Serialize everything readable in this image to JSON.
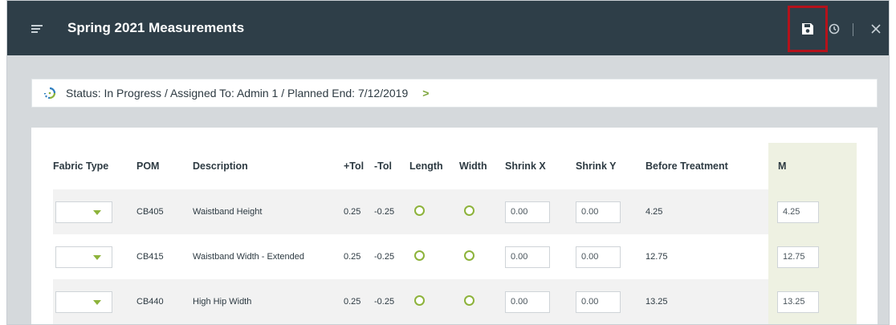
{
  "header": {
    "title": "Spring 2021 Measurements",
    "icons": [
      "menu-icon",
      "save-icon",
      "history-icon",
      "close-icon"
    ],
    "highlight_color": "#b5121b"
  },
  "status": {
    "text": "Status: In Progress / Assigned To: Admin 1 / Planned End: 7/12/2019",
    "chevron": ">"
  },
  "table": {
    "columns": [
      "Fabric Type",
      "POM",
      "Description",
      "+Tol",
      "-Tol",
      "Length",
      "Width",
      "Shrink X",
      "Shrink Y",
      "Before Treatment",
      "M"
    ],
    "rows": [
      {
        "fabric_type": "",
        "pom": "CB405",
        "description": "Waistband Height",
        "plus_tol": "0.25",
        "minus_tol": "-0.25",
        "shrink_x": "0.00",
        "shrink_y": "0.00",
        "before_treatment": "4.25",
        "m": "4.25"
      },
      {
        "fabric_type": "",
        "pom": "CB415",
        "description": "Waistband Width - Extended",
        "plus_tol": "0.25",
        "minus_tol": "-0.25",
        "shrink_x": "0.00",
        "shrink_y": "0.00",
        "before_treatment": "12.75",
        "m": "12.75"
      },
      {
        "fabric_type": "",
        "pom": "CB440",
        "description": "High Hip Width",
        "plus_tol": "0.25",
        "minus_tol": "-0.25",
        "shrink_x": "0.00",
        "shrink_y": "0.00",
        "before_treatment": "13.25",
        "m": "13.25"
      }
    ]
  },
  "colors": {
    "header_bg": "#2e3e48",
    "accent_green": "#8db33b",
    "m_column_bg": "#eef1e2"
  }
}
